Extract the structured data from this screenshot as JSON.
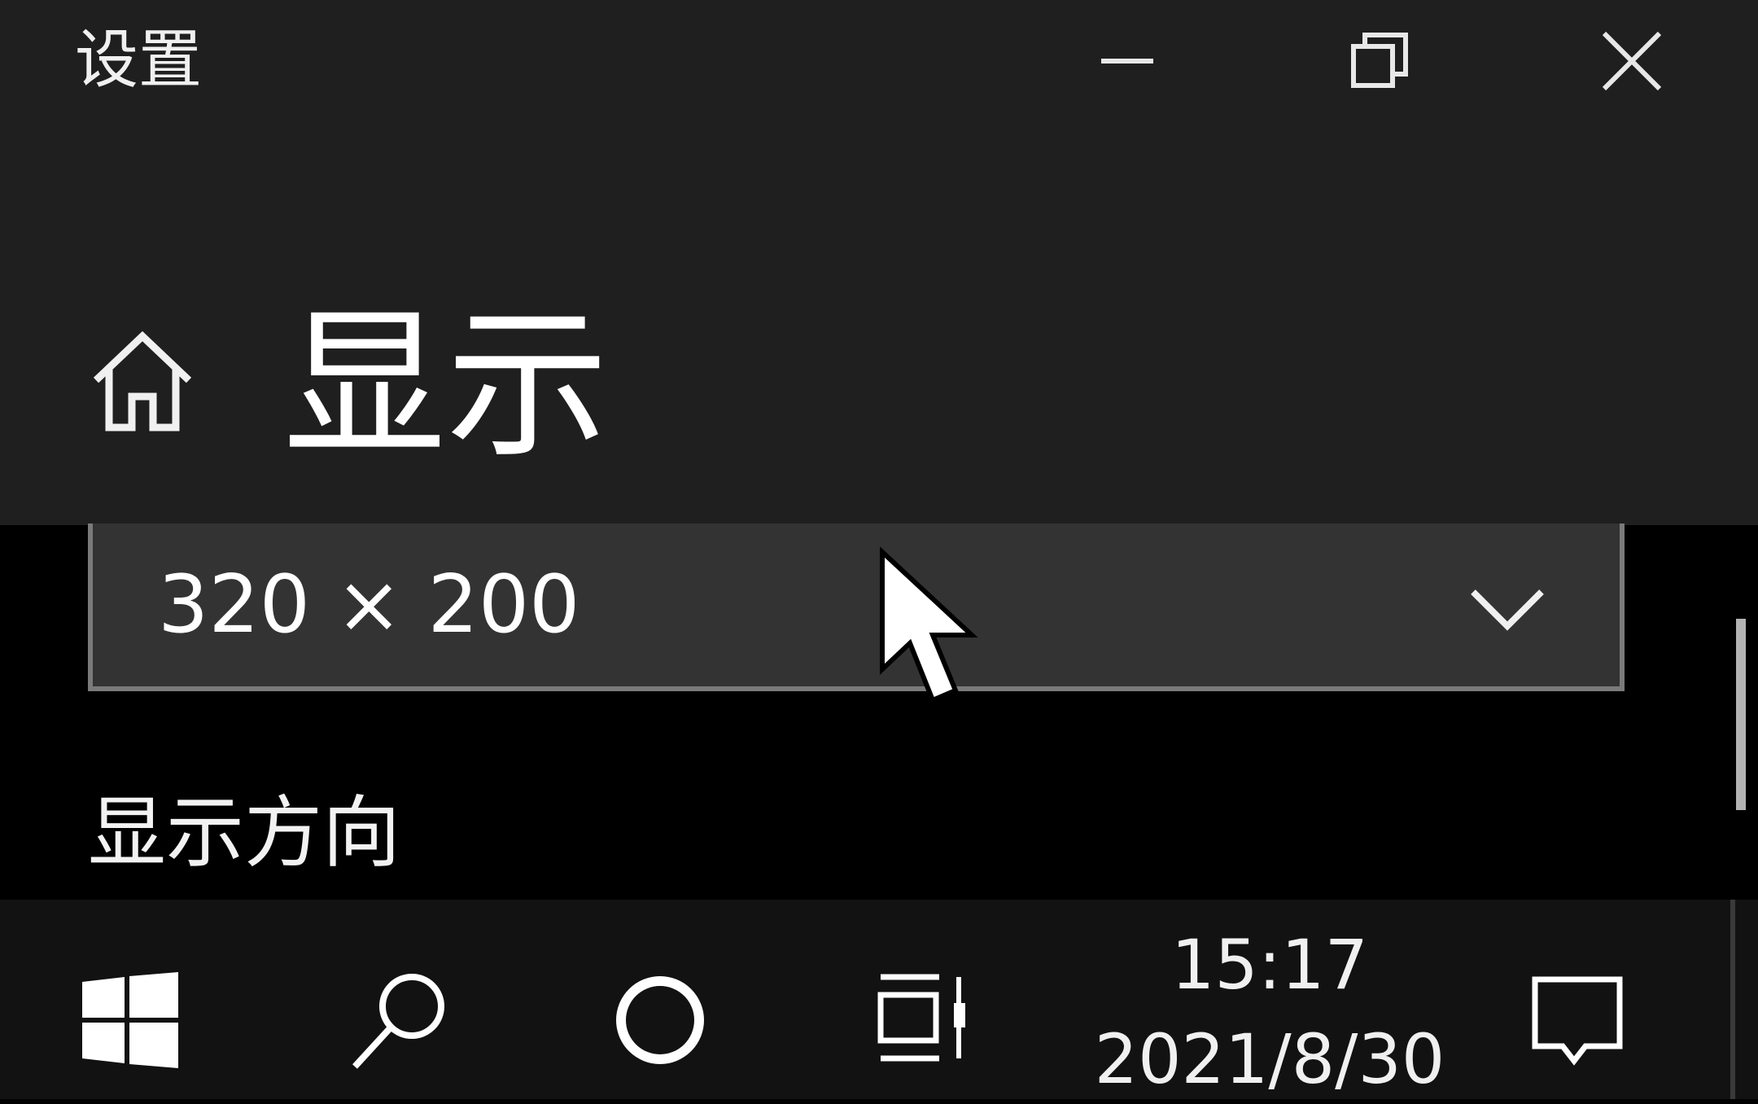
{
  "window": {
    "app_title": "设置",
    "page_title": "显示",
    "buttons": {
      "minimize": "minimize-icon",
      "maximize": "restore-icon",
      "close": "close-icon"
    },
    "home_icon": "home-icon"
  },
  "content": {
    "resolution_dropdown": {
      "selected": "320 × 200",
      "icon": "chevron-down-icon"
    },
    "orientation_label": "显示方向"
  },
  "taskbar": {
    "icons": [
      "windows-start-icon",
      "search-icon",
      "cortana-icon",
      "task-view-icon",
      "notification-icon"
    ],
    "clock": {
      "time": "15:17",
      "date": "2021/8/30"
    }
  },
  "colors": {
    "titlebar_bg": "#1f1f1f",
    "content_bg": "#000000",
    "dropdown_bg": "#333333",
    "dropdown_border": "#7a7a7a",
    "taskbar_bg": "#121212",
    "text": "#ffffff"
  }
}
